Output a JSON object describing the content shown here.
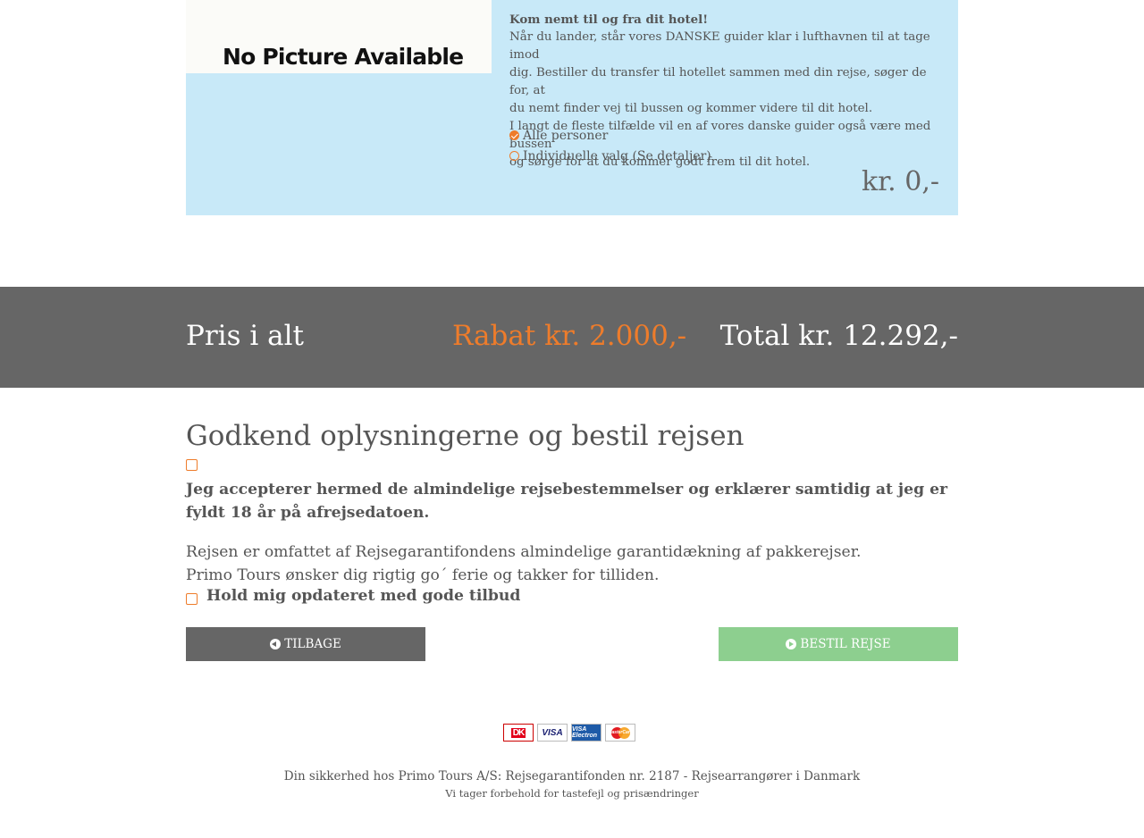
{
  "transfer": {
    "image_text": "No Picture Available",
    "heading": "Kom nemt til og fra dit hotel!",
    "lines": [
      "Når du lander, står vores DANSKE guider klar i lufthavnen til at tage imod",
      "dig. Bestiller du transfer til hotellet sammen med din rejse, søger de for, at",
      "du nemt finder vej til bussen og kommer videre til dit hotel.",
      "I langt de fleste tilfælde vil en af vores danske guider også være med bussen",
      "og sørge for at du kommer godt frem til dit hotel."
    ],
    "options": [
      {
        "label": "Alle personer",
        "selected": true
      },
      {
        "label": "Individuelle valg (Se detaljer)",
        "selected": false
      }
    ],
    "price": "kr. 0,-"
  },
  "summary": {
    "label": "Pris i alt",
    "discount": "Rabat kr. 2.000,-",
    "total": "Total kr. 12.292,-"
  },
  "confirm": {
    "title": "Godkend oplysningerne og bestil rejsen",
    "accept_text": "Jeg accepterer hermed de almindelige rejsebestemmelser og erklærer samtidig at jeg er fyldt 18 år på afrejsedatoen.",
    "info_line1": "Rejsen er omfattet af Rejsegarantifondens almindelige garantidækning af pakkerejser.",
    "info_line2": "Primo Tours ønsker dig rigtig go´ ferie og takker for tilliden.",
    "newsletter_label": "Hold mig opdateret med gode tilbud",
    "back_label": "TILBAGE",
    "order_label": "BESTIL REJSE"
  },
  "footer": {
    "payment_cards": [
      "DK",
      "VISA",
      "VISA Electron",
      "MasterCard"
    ],
    "security": "Din sikkerhed hos Primo Tours A/S: Rejsegarantifonden nr. 2187 - Rejsearrangører i Danmark",
    "disclaimer": "Vi tager forbehold for tastefejl og prisændringer"
  },
  "colors": {
    "accent": "#ee7c2b",
    "card_bg": "#c8e9f8",
    "band_bg": "#666666",
    "order_button": "#8dcf8f"
  }
}
